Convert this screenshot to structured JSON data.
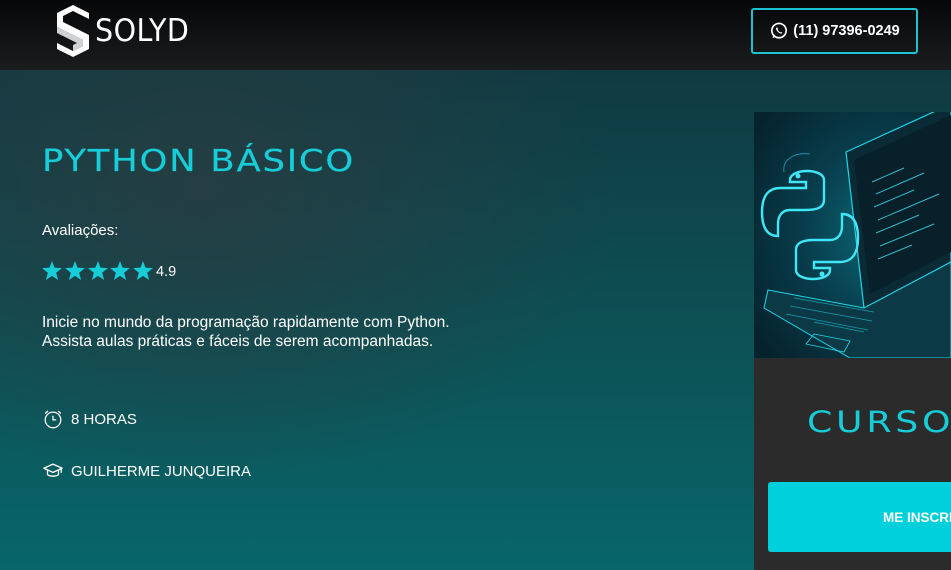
{
  "header": {
    "logo_text": "SOLYD",
    "phone": "(11) 97396-0249",
    "phone_icon": "whatsapp-icon"
  },
  "course": {
    "title": "PYTHON BÁSICO",
    "ratings_label": "Avaliações:",
    "rating_value": "4.9",
    "stars": 5,
    "description_line1": "Inicie no mundo da programação rapidamente com Python.",
    "description_line2": "Assista aulas práticas e fáceis de serem acompanhadas.",
    "duration": "8 HORAS",
    "instructor": "GUILHERME JUNQUEIRA"
  },
  "card": {
    "title": "CURSO",
    "enroll_label": "ME INSCREVER"
  },
  "colors": {
    "accent": "#16cdd8",
    "button": "#00cfdc",
    "header_bg": "#111315",
    "card_bg": "#2b2b2b"
  }
}
